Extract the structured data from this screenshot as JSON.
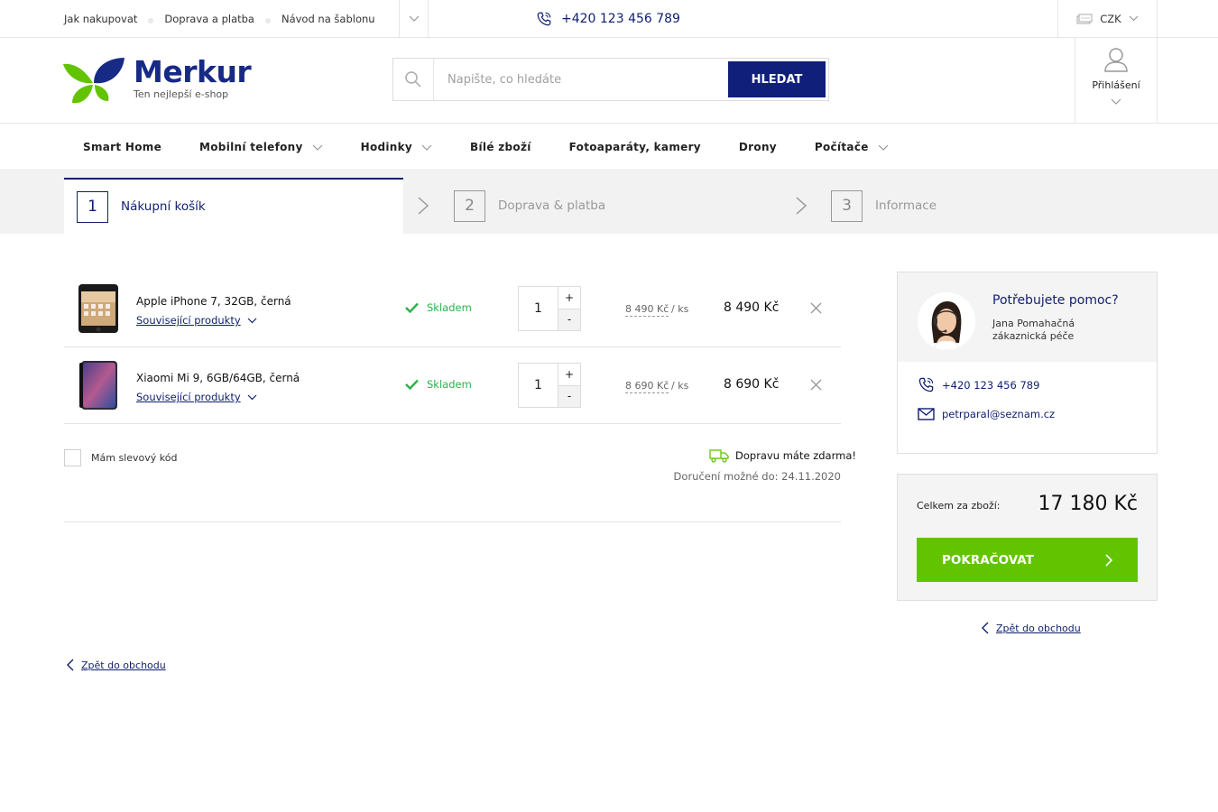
{
  "topbar": {
    "links": [
      "Jak nakupovat",
      "Doprava a platba",
      "Návod na šablonu"
    ],
    "phone": "+420 123 456 789",
    "currency": "CZK"
  },
  "header": {
    "logo_name": "Merkur",
    "logo_tagline": "Ten nejlepší e-shop",
    "search_placeholder": "Napište, co hledáte",
    "search_button": "HLEDAT",
    "login_label": "Přihlášení"
  },
  "nav": {
    "items": [
      "Smart Home",
      "Mobilní telefony",
      "Hodinky",
      "Bílé zboží",
      "Fotoaparáty, kamery",
      "Drony",
      "Počítače"
    ]
  },
  "steps": [
    {
      "num": "1",
      "label": "Nákupní košík"
    },
    {
      "num": "2",
      "label": "Doprava & platba"
    },
    {
      "num": "3",
      "label": "Informace"
    }
  ],
  "cart": {
    "items": [
      {
        "name": "Apple iPhone 7, 32GB, černá",
        "related": "Související produkty",
        "stock": "Skladem",
        "qty": "1",
        "unit_price": "8 490 Kč",
        "unit_suffix": "/ ks",
        "total": "8 490 Kč"
      },
      {
        "name": "Xiaomi Mi 9, 6GB/64GB, černá",
        "related": "Související produkty",
        "stock": "Skladem",
        "qty": "1",
        "unit_price": "8 690 Kč",
        "unit_suffix": "/ ks",
        "total": "8 690 Kč"
      }
    ],
    "qty_plus": "+",
    "qty_minus": "-",
    "discount_label": "Mám slevový kód",
    "free_shipping": "Dopravu máte zdarma!",
    "delivery": "Doručení možné do: 24.11.2020",
    "back_link": "Zpět do obchodu"
  },
  "help": {
    "title": "Potřebujete pomoc?",
    "name": "Jana Pomahačná",
    "role": "zákaznická péče",
    "phone": "+420 123 456 789",
    "email": "petrparal@seznam.cz"
  },
  "summary": {
    "label": "Celkem za zboží:",
    "value": "17 180 Kč",
    "continue_button": "POKRAČOVAT",
    "back_link": "Zpět do obchodu"
  },
  "colors": {
    "brand": "#172a86",
    "accent_green": "#62c400",
    "stock_green": "#2cb24a"
  }
}
